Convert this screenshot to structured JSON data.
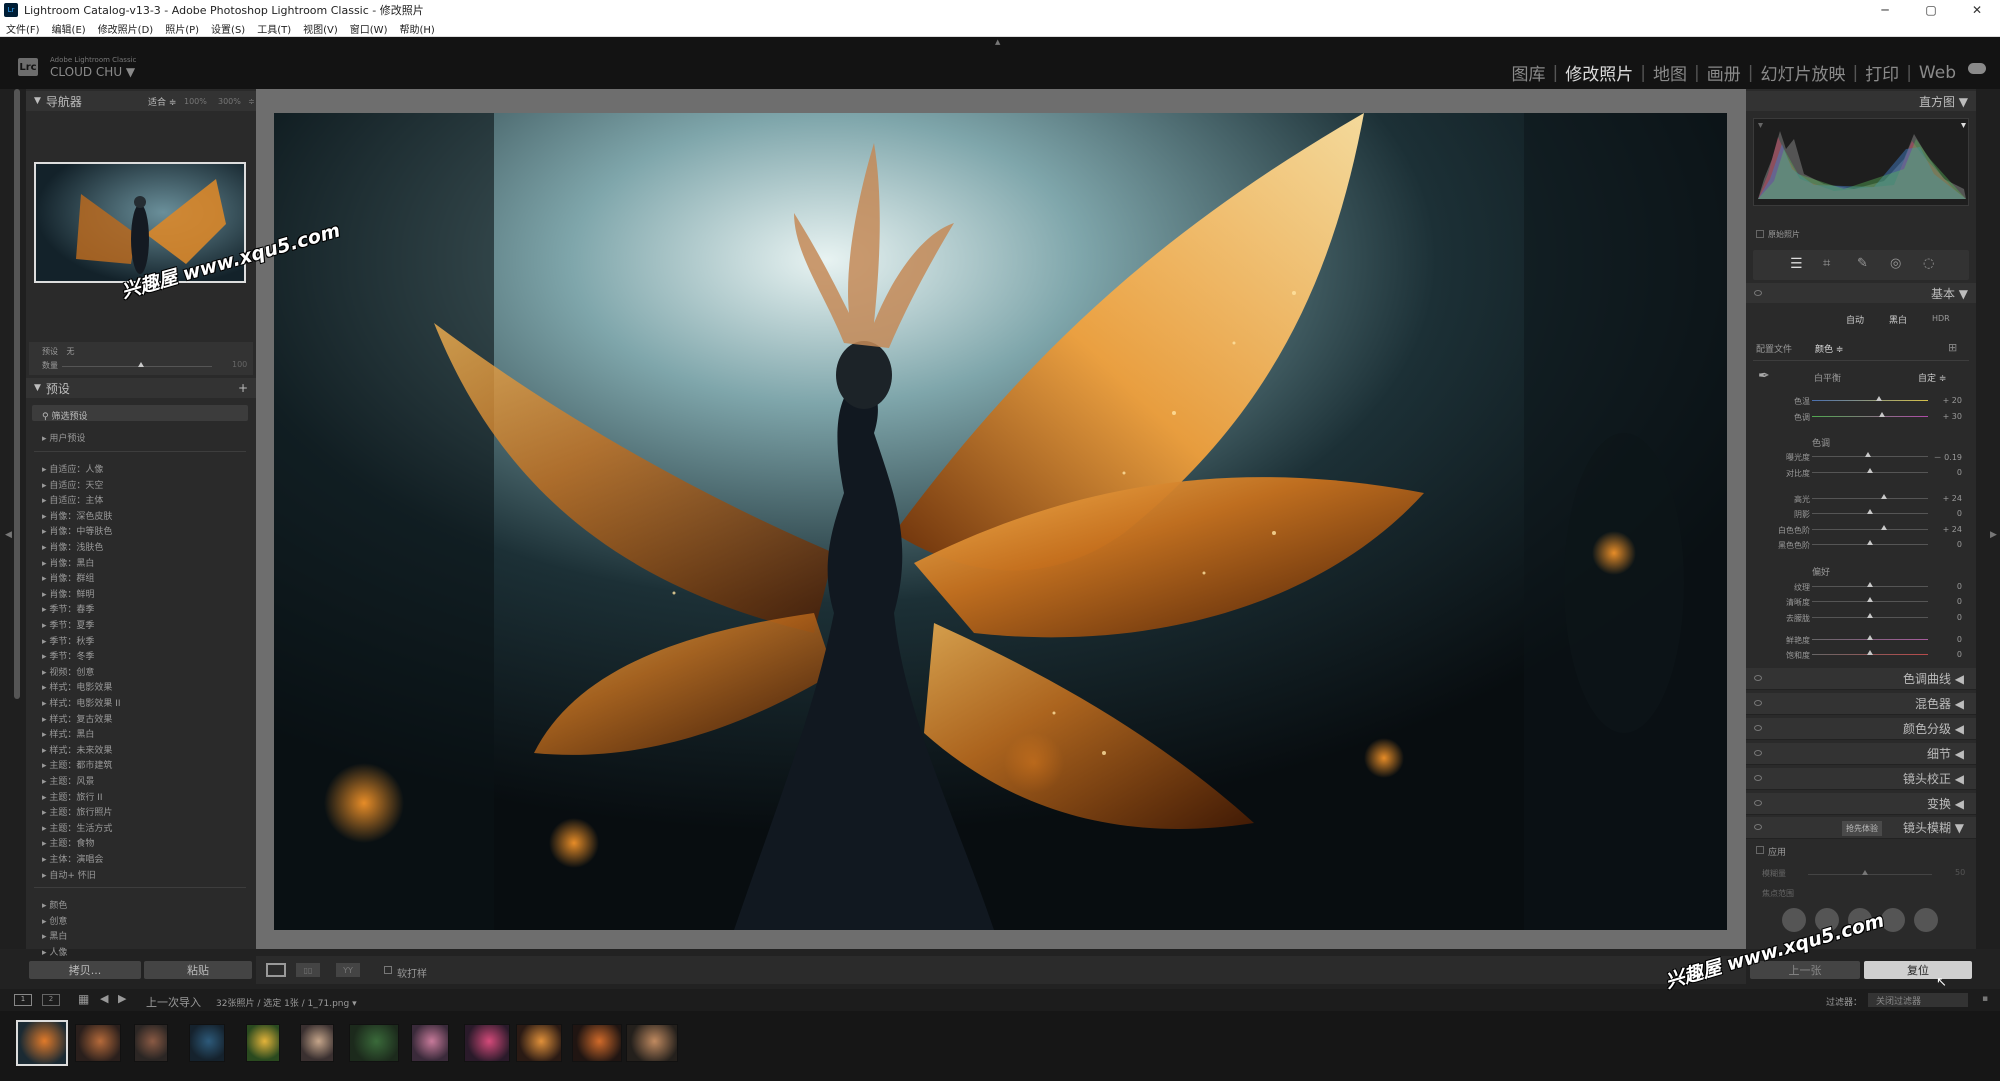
{
  "window": {
    "title": "Lightroom Catalog-v13-3 - Adobe Photoshop Lightroom Classic - 修改照片",
    "controls": [
      "─",
      "▢",
      "✕"
    ]
  },
  "menu": [
    "文件(F)",
    "编辑(E)",
    "修改照片(D)",
    "照片(P)",
    "设置(S)",
    "工具(T)",
    "视图(V)",
    "窗口(W)",
    "帮助(H)"
  ],
  "identity": {
    "logo": "Lrc",
    "sub": "Adobe Lightroom Classic",
    "user": "CLOUD CHU ▼"
  },
  "modules": [
    {
      "label": "图库",
      "active": false
    },
    {
      "label": "修改照片",
      "active": true
    },
    {
      "label": "地图",
      "active": false
    },
    {
      "label": "画册",
      "active": false
    },
    {
      "label": "幻灯片放映",
      "active": false
    },
    {
      "label": "打印",
      "active": false
    },
    {
      "label": "Web",
      "active": false
    }
  ],
  "navigator": {
    "title": "导航器",
    "zoom_fit": "适合 ≑",
    "zoom_100": "100%",
    "zoom_300": "300%"
  },
  "preset_amount": {
    "label1": "预设",
    "label1_value": "无",
    "label2": "数量",
    "end": "100"
  },
  "presets": {
    "title": "预设",
    "add": "+",
    "groups_top": [
      "筛选预设",
      "用户预设"
    ],
    "items": [
      "自适应：人像",
      "自适应：天空",
      "自适应：主体",
      "肖像：深色皮肤",
      "肖像：中等肤色",
      "肖像：浅肤色",
      "肖像：黑白",
      "肖像：群组",
      "肖像：鲜明",
      "季节：春季",
      "季节：夏季",
      "季节：秋季",
      "季节：冬季",
      "视频：创意",
      "样式：电影效果",
      "样式：电影效果 II",
      "样式：复古效果",
      "样式：黑白",
      "样式：未来效果",
      "主题：都市建筑",
      "主题：风景",
      "主题：旅行 II",
      "主题：旅行照片",
      "主题：生活方式",
      "主题：食物",
      "主体：演唱会",
      "自动+ 怀旧"
    ],
    "items_bottom": [
      "颜色",
      "创意",
      "黑白",
      "人像"
    ]
  },
  "left_buttons": {
    "copy": "拷贝...",
    "paste": "粘贴"
  },
  "histogram": {
    "title": "直方图 ▼",
    "original": "原始照片"
  },
  "basic": {
    "title": "基本 ▼",
    "modes": [
      "自动",
      "黑白",
      "HDR"
    ],
    "profile_label": "配置文件",
    "profile_value": "颜色 ≑",
    "wb_label": "白平衡",
    "wb_value": "自定 ≑",
    "wb_sliders": [
      {
        "label": "色温",
        "value": "+ 20",
        "pos": 0.58
      },
      {
        "label": "色调",
        "value": "+ 30",
        "pos": 0.6
      }
    ],
    "tone_title": "色调",
    "tone_sliders": [
      {
        "label": "曝光度",
        "value": "－ 0.19",
        "pos": 0.48
      },
      {
        "label": "对比度",
        "value": "0",
        "pos": 0.5
      },
      {
        "label": "高光",
        "value": "+ 24",
        "pos": 0.62
      },
      {
        "label": "阴影",
        "value": "0",
        "pos": 0.5
      },
      {
        "label": "白色色阶",
        "value": "+ 24",
        "pos": 0.62
      },
      {
        "label": "黑色色阶",
        "value": "0",
        "pos": 0.5
      }
    ],
    "presence_title": "偏好",
    "presence_sliders": [
      {
        "label": "纹理",
        "value": "0",
        "pos": 0.5
      },
      {
        "label": "清晰度",
        "value": "0",
        "pos": 0.5
      },
      {
        "label": "去朦胧",
        "value": "0",
        "pos": 0.5
      },
      {
        "label": "鲜艳度",
        "value": "0",
        "pos": 0.5
      },
      {
        "label": "饱和度",
        "value": "0",
        "pos": 0.5
      }
    ]
  },
  "sections": [
    "色调曲线 ◀",
    "混色器 ◀",
    "颜色分级 ◀",
    "细节 ◀",
    "镜头校正 ◀",
    "变换 ◀"
  ],
  "lens_blur": {
    "title": "镜头模糊 ▼",
    "badge": "抢先体验",
    "apply": "应用",
    "amount_label": "模糊量",
    "amount_value": "50",
    "focus_label": "焦点范围"
  },
  "right_buttons": {
    "prev": "上一张",
    "reset": "复位"
  },
  "toolbar": {
    "softproof": "软打样"
  },
  "filmbar": {
    "source": "上一次导入",
    "count": "32张照片 / 选定 1张 / 1_71.png ▾",
    "filter_label": "过滤器：",
    "filter_value": "关闭过滤器"
  },
  "watermark": "兴趣屋 www.xqu5.com"
}
